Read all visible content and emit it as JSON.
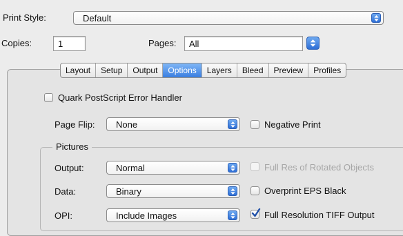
{
  "print_style": {
    "label": "Print Style:",
    "value": "Default"
  },
  "copies": {
    "label": "Copies:",
    "value": "1"
  },
  "pages": {
    "label": "Pages:",
    "value": "All"
  },
  "tabs": [
    {
      "label": "Layout",
      "selected": false
    },
    {
      "label": "Setup",
      "selected": false
    },
    {
      "label": "Output",
      "selected": false
    },
    {
      "label": "Options",
      "selected": true
    },
    {
      "label": "Layers",
      "selected": false
    },
    {
      "label": "Bleed",
      "selected": false
    },
    {
      "label": "Preview",
      "selected": false
    },
    {
      "label": "Profiles",
      "selected": false
    }
  ],
  "options": {
    "quark_ps_error_handler": {
      "label": "Quark PostScript Error Handler",
      "checked": false
    },
    "page_flip": {
      "label": "Page Flip:",
      "value": "None"
    },
    "negative_print": {
      "label": "Negative Print",
      "checked": false
    },
    "pictures": {
      "title": "Pictures",
      "output": {
        "label": "Output:",
        "value": "Normal"
      },
      "data": {
        "label": "Data:",
        "value": "Binary"
      },
      "opi": {
        "label": "OPI:",
        "value": "Include Images"
      },
      "full_res_rotated": {
        "label": "Full Res of Rotated Objects",
        "checked": false,
        "disabled": true
      },
      "overprint_eps_black": {
        "label": "Overprint EPS Black",
        "checked": false
      },
      "full_res_tiff": {
        "label": "Full Resolution TIFF Output",
        "checked": true
      }
    }
  },
  "colors": {
    "accent": "#3a7ee0",
    "check": "#1f4fa8"
  }
}
